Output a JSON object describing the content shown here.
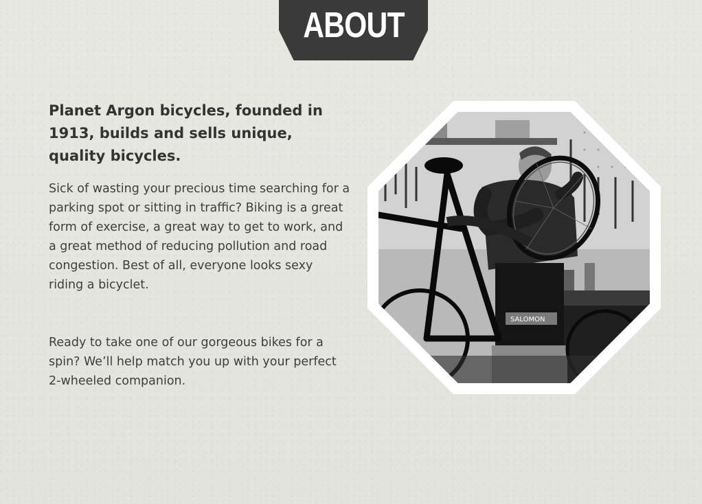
{
  "header": {
    "title": "ABOUT"
  },
  "about": {
    "heading": "Planet Argon bicycles, founded in 1913, builds and sells unique, quality bicycles.",
    "paragraphs": [
      "Sick of wasting your precious time searching for a parking spot or sitting in traffic? Biking is a great form of exercise, a great way to get to work, and a great method of reducing pollution and road congestion. Best of all, everyone looks sexy riding a bicyclet.",
      "Ready to take one of our gorgeous bikes for a spin? We’ll help match you up with your perfect 2-wheeled companion."
    ]
  },
  "photo": {
    "subject": "man-repairing-bicycle-wheel-in-workshop",
    "style": "black-and-white",
    "shape": "octagon",
    "frame_color": "#ffffff",
    "apron_text": "SALOMON"
  },
  "colors": {
    "background": "#e6e6e1",
    "tab": "#3a3a3a",
    "tab_text": "#ffffff",
    "heading_text": "#333333",
    "body_text": "#3d3d3d"
  }
}
